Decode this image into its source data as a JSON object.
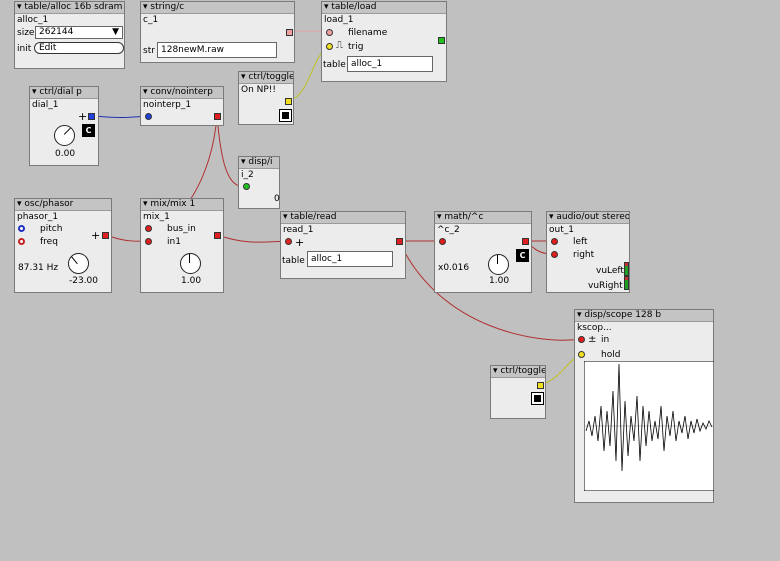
{
  "objects": {
    "alloc": {
      "type": "table/alloc 16b sdram",
      "name": "alloc_1",
      "size_label": "size",
      "size_value": "262144",
      "init_label": "init",
      "init_button": "Edit"
    },
    "string": {
      "type": "string/c",
      "name": "c_1",
      "str_label": "str",
      "str_value": "128newM.raw"
    },
    "tload": {
      "type": "table/load",
      "name": "load_1",
      "filename_label": "filename",
      "trig_label": "trig",
      "table_label": "table",
      "table_value": "alloc_1"
    },
    "toggle1": {
      "type": "ctrl/toggle",
      "name": "On NP!!"
    },
    "dial": {
      "type": "ctrl/dial p",
      "name": "dial_1",
      "value": "0.00"
    },
    "noint": {
      "type": "conv/nointerp",
      "name": "nointerp_1"
    },
    "dispi": {
      "type": "disp/i",
      "name": "i_2",
      "value": "0"
    },
    "phasor": {
      "type": "osc/phasor",
      "name": "phasor_1",
      "pitch_label": "pitch",
      "freq_label": "freq",
      "freq_readout": "87.31 Hz",
      "knob_value": "-23.00"
    },
    "mix": {
      "type": "mix/mix 1",
      "name": "mix_1",
      "bus_label": "bus_in",
      "in_label": "in1",
      "knob_value": "1.00"
    },
    "tread": {
      "type": "table/read",
      "name": "read_1",
      "table_label": "table",
      "table_value": "alloc_1"
    },
    "pow": {
      "type": "math/^c",
      "name": "^c_2",
      "mult_label": "x0.016",
      "knob_value": "1.00"
    },
    "audio": {
      "type": "audio/out stereo",
      "name": "out_1",
      "left_label": "left",
      "right_label": "right",
      "vul_label": "vuLeft",
      "vur_label": "vuRight"
    },
    "scope": {
      "type": "disp/scope 128 b",
      "name": "kscop...",
      "in_label": "in",
      "hold_label": "hold"
    },
    "toggle2": {
      "type": "ctrl/toggle",
      "name": ""
    }
  },
  "colors": {
    "audio_wire": "#b03030",
    "frac_wire": "#2030b0",
    "bool_wire": "#c0c020",
    "canvas": "#c0c0c0"
  }
}
